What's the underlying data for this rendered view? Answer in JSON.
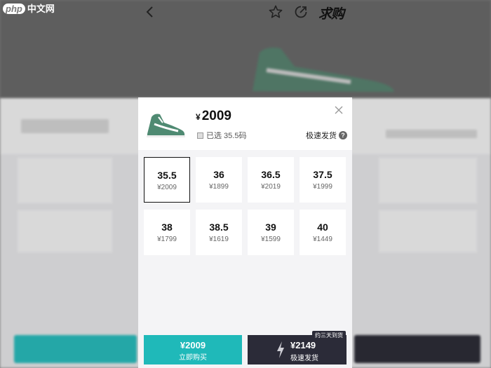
{
  "watermark": {
    "logo": "php",
    "text": "中文网"
  },
  "nav": {
    "back_icon": "chevron-left-icon",
    "brand": "求购"
  },
  "product": {
    "currency": "¥",
    "price": "2009",
    "selected_label": "已选 35.5码",
    "fast_ship_label": "极速发货",
    "help_glyph": "?"
  },
  "sizes": [
    {
      "size": "35.5",
      "price": "¥2009",
      "selected": true
    },
    {
      "size": "36",
      "price": "¥1899",
      "selected": false
    },
    {
      "size": "36.5",
      "price": "¥2019",
      "selected": false
    },
    {
      "size": "37.5",
      "price": "¥1999",
      "selected": false
    },
    {
      "size": "38",
      "price": "¥1799",
      "selected": false
    },
    {
      "size": "38.5",
      "price": "¥1619",
      "selected": false
    },
    {
      "size": "39",
      "price": "¥1599",
      "selected": false
    },
    {
      "size": "40",
      "price": "¥1449",
      "selected": false
    }
  ],
  "actions": {
    "buy_now": {
      "price": "¥2009",
      "label": "立即购买"
    },
    "fast_buy": {
      "price": "¥2149",
      "label": "极速发货",
      "badge": "约三天到货"
    }
  },
  "colors": {
    "accent_teal": "#1fb9b9",
    "dark_button": "#2b2b38",
    "shoe_green": "#4f8a72"
  }
}
